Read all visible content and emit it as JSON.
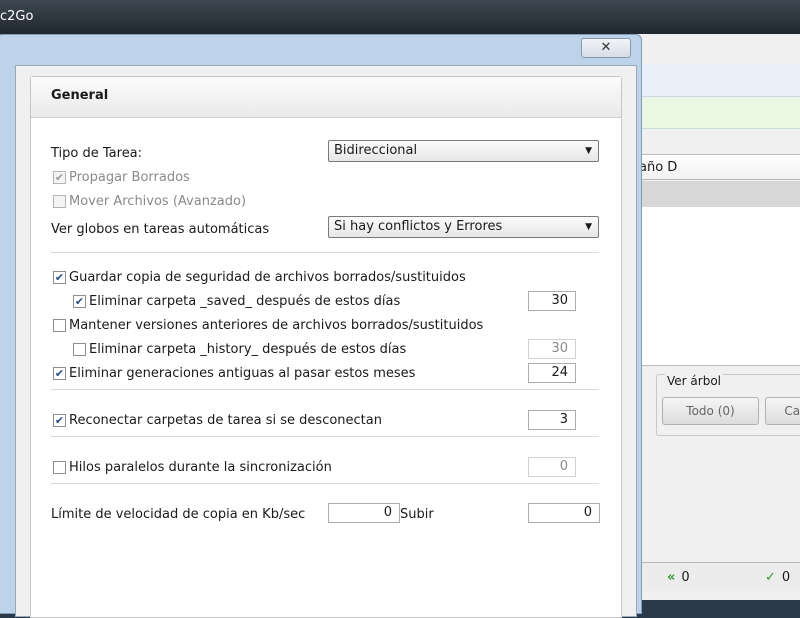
{
  "window": {
    "title_fragment": "c2Go"
  },
  "background": {
    "column_header": "año D",
    "tree_group_label": "Ver árbol",
    "tree_button_all": "Todo (0)",
    "tree_button_cut": "Can",
    "status_left_value": "0",
    "status_right_value": "0"
  },
  "dialog": {
    "close_glyph": "✕",
    "panel_title": "General",
    "task_type_label": "Tipo de Tarea:",
    "task_type_value": "Bidireccional",
    "propagate_deletes": {
      "label": "Propagar Borrados",
      "checked": true,
      "enabled": false
    },
    "move_files": {
      "label": "Mover Archivos (Avanzado)",
      "checked": false,
      "enabled": false
    },
    "balloons_label": "Ver globos en tareas automáticas",
    "balloons_value": "Si hay conflictos y Errores",
    "backup_deleted": {
      "label": "Guardar copia de seguridad de archivos borrados/sustituidos",
      "checked": true
    },
    "delete_saved": {
      "label": "Eliminar carpeta _saved_ después de estos días",
      "checked": true,
      "value": "30"
    },
    "keep_versions": {
      "label": "Mantener versiones anteriores de archivos borrados/sustituidos",
      "checked": false
    },
    "delete_history": {
      "label": "Eliminar carpeta _history_ después de estos días",
      "checked": false,
      "value": "30"
    },
    "delete_generations": {
      "label": "Eliminar generaciones antiguas al pasar estos meses",
      "checked": true,
      "value": "24"
    },
    "reconnect": {
      "label": "Reconectar carpetas de tarea si se desconectan",
      "checked": true,
      "value": "3"
    },
    "parallel_threads": {
      "label": "Hilos paralelos durante la sincronización",
      "checked": false,
      "value": "0"
    },
    "speed_limit_label": "Límite de velocidad de copia en Kb/sec",
    "speed_limit_download": "0",
    "upload_label": "Subir",
    "speed_limit_upload": "0"
  }
}
